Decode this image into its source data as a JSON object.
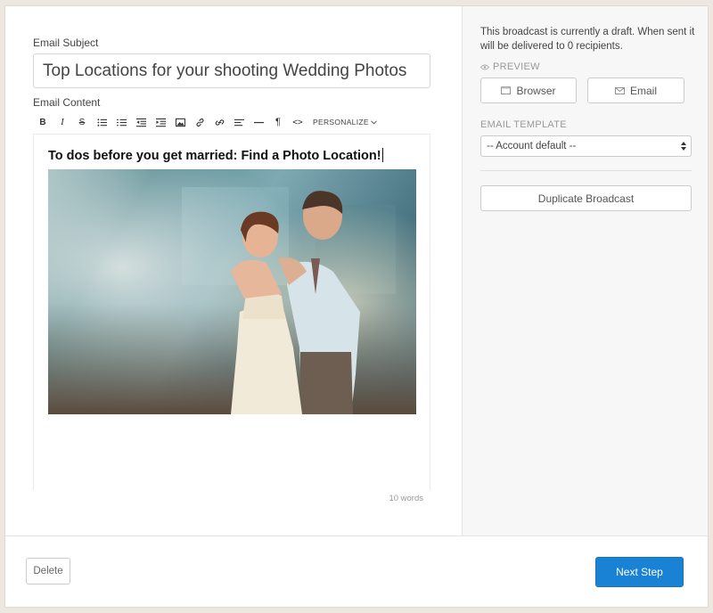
{
  "editor": {
    "subject_label": "Email Subject",
    "subject_value": "Top Locations for your shooting Wedding Photos",
    "content_label": "Email Content",
    "toolbar": {
      "bold": "B",
      "italic": "I",
      "strike": "S",
      "paragraph": "¶",
      "code": "<>",
      "personalize": "PERSONALIZE"
    },
    "heading": "To dos before you get married: Find a Photo Location!",
    "image_icon": "wedding-photo",
    "word_count": "10 words"
  },
  "sidebar": {
    "draft_note": "This broadcast is currently a draft. When sent it will be delivered to 0 recipients.",
    "preview_label": "PREVIEW",
    "browser_button": "Browser",
    "email_button": "Email",
    "template_label": "EMAIL TEMPLATE",
    "template_value": "-- Account default --",
    "duplicate_button": "Duplicate Broadcast"
  },
  "footer": {
    "delete_button": "Delete",
    "next_button": "Next Step"
  },
  "colors": {
    "primary": "#1a82d4",
    "background": "#ece8df"
  }
}
